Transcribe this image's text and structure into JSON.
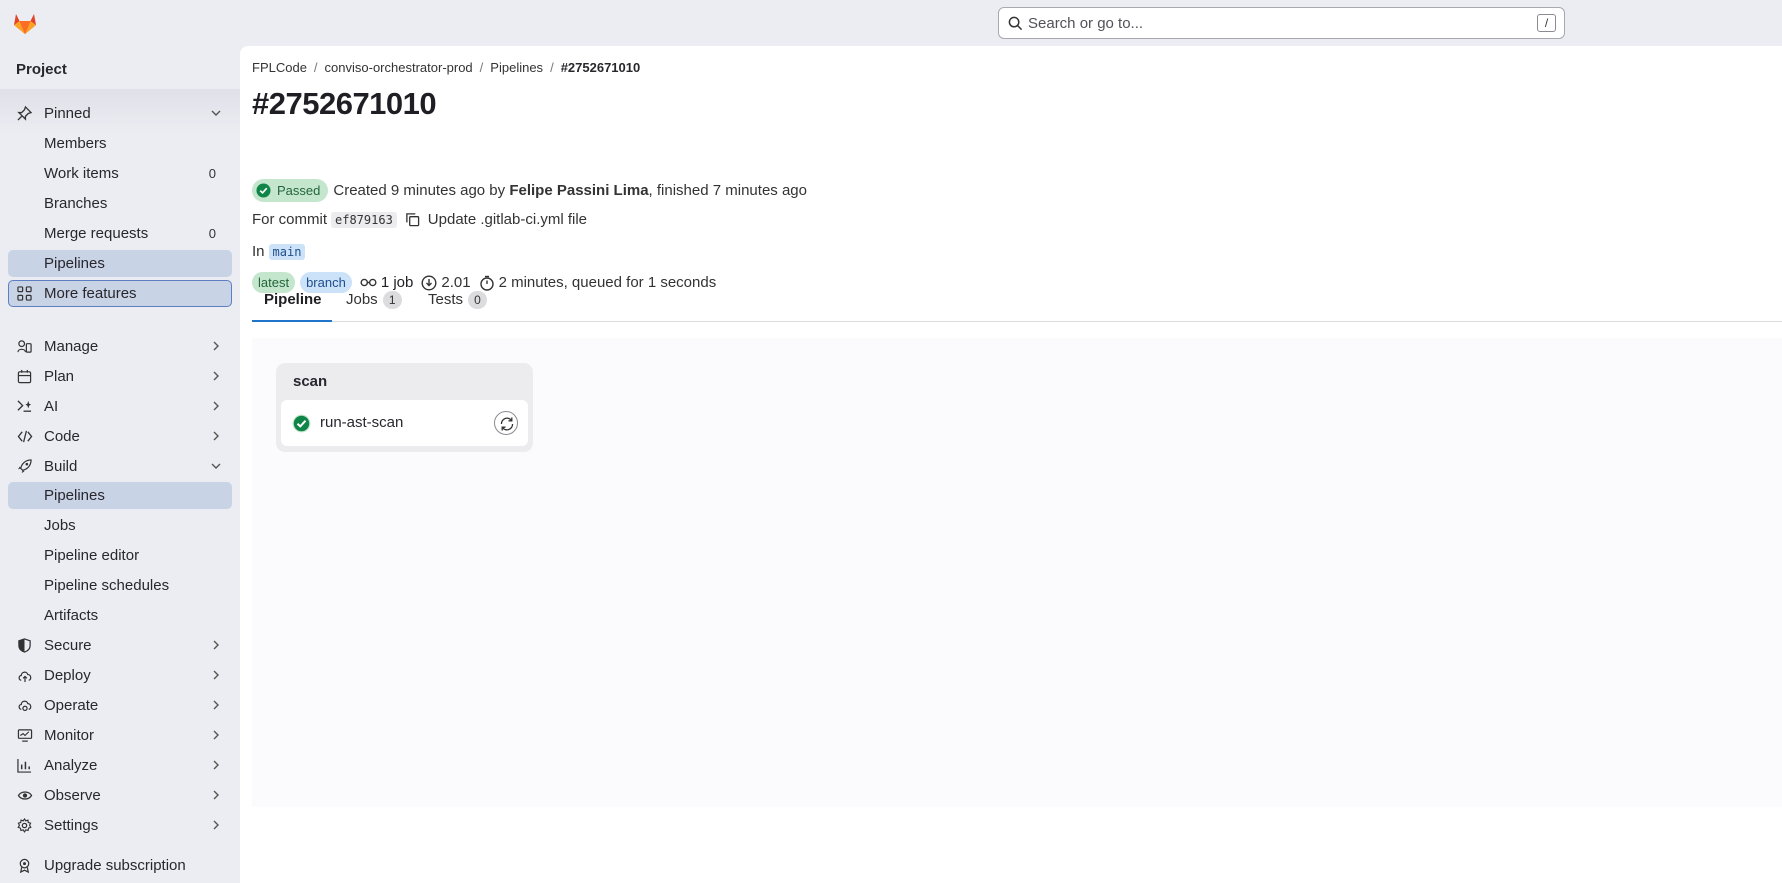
{
  "search": {
    "placeholder": "Search or go to...",
    "shortcut": "/"
  },
  "sidebar": {
    "title": "Project",
    "items": [
      {
        "label": "Pinned",
        "icon": "pin-icon"
      },
      {
        "label": "Members"
      },
      {
        "label": "Work items",
        "count": "0"
      },
      {
        "label": "Branches"
      },
      {
        "label": "Merge requests",
        "count": "0"
      },
      {
        "label": "Pipelines"
      },
      {
        "label": "More features",
        "icon": "grid-icon"
      },
      {
        "label": "Manage",
        "icon": "users-icon"
      },
      {
        "label": "Plan",
        "icon": "calendar-icon"
      },
      {
        "label": "AI",
        "icon": "ai-icon"
      },
      {
        "label": "Code",
        "icon": "code-icon"
      },
      {
        "label": "Build",
        "icon": "rocket-icon"
      },
      {
        "label": "Pipelines"
      },
      {
        "label": "Jobs"
      },
      {
        "label": "Pipeline editor"
      },
      {
        "label": "Pipeline schedules"
      },
      {
        "label": "Artifacts"
      },
      {
        "label": "Secure",
        "icon": "shield-icon"
      },
      {
        "label": "Deploy",
        "icon": "cloud-upload-icon"
      },
      {
        "label": "Operate",
        "icon": "cloud-gear-icon"
      },
      {
        "label": "Monitor",
        "icon": "monitor-icon"
      },
      {
        "label": "Analyze",
        "icon": "chart-icon"
      },
      {
        "label": "Observe",
        "icon": "eye-icon"
      },
      {
        "label": "Settings",
        "icon": "gear-icon"
      },
      {
        "label": "Upgrade subscription",
        "icon": "badge-icon"
      }
    ]
  },
  "breadcrumb": [
    "FPLCode",
    "conviso-orchestrator-prod",
    "Pipelines",
    "#2752671010"
  ],
  "pipeline": {
    "title": "#2752671010",
    "status": "Passed",
    "created_prefix": "Created 9 minutes ago by",
    "author": "Felipe Passini Lima",
    "finished_suffix": ", finished 7 minutes ago",
    "commit_prefix": "For commit",
    "commit_sha": "ef879163",
    "commit_message": "Update .gitlab-ci.yml file",
    "in_prefix": "In",
    "ref": "main",
    "tags": [
      "latest",
      "branch"
    ],
    "jobs_count": "1 job",
    "compute": "2.01",
    "duration": "2 minutes, queued for 1 seconds"
  },
  "tabs": [
    {
      "label": "Pipeline"
    },
    {
      "label": "Jobs",
      "count": "1"
    },
    {
      "label": "Tests",
      "count": "0"
    }
  ],
  "graph": {
    "stage_name": "scan",
    "job_name": "run-ast-scan"
  },
  "colors": {
    "accent": "#1f75cb",
    "success": "#108548",
    "active_nav": "#c9d3e6"
  }
}
